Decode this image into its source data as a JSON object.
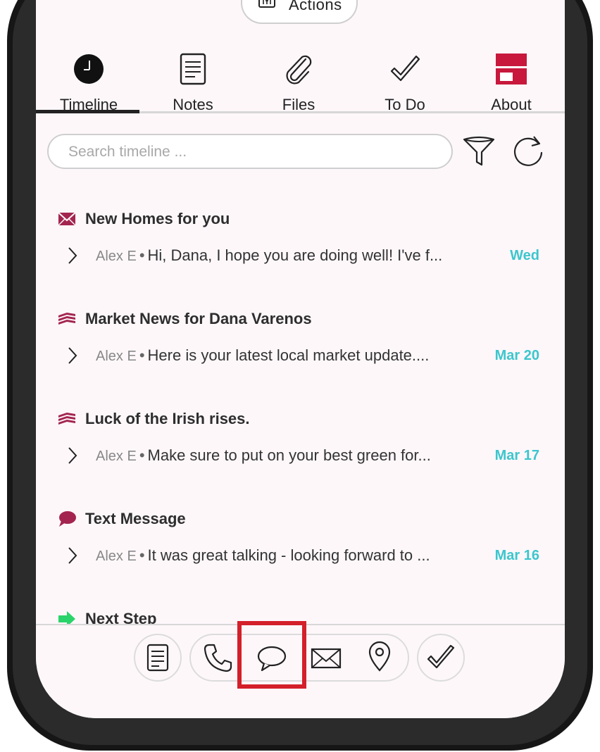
{
  "header": {
    "actions_label": "Actions"
  },
  "tabs": [
    {
      "label": "Timeline",
      "icon": "clock-icon",
      "active": true
    },
    {
      "label": "Notes",
      "icon": "notes-icon",
      "active": false
    },
    {
      "label": "Files",
      "icon": "paperclip-icon",
      "active": false
    },
    {
      "label": "To Do",
      "icon": "checkmark-icon",
      "active": false
    },
    {
      "label": "About",
      "icon": "about-card-icon",
      "active": false
    }
  ],
  "search": {
    "placeholder": "Search timeline ...",
    "value": ""
  },
  "timeline": [
    {
      "type_icon": "envelope-icon",
      "title": "New Homes for you",
      "author": "Alex E",
      "preview": "Hi, Dana, I hope you are doing well! I've f...",
      "date": "Wed"
    },
    {
      "type_icon": "newsletter-stack-icon",
      "title": "Market News for Dana Varenos",
      "author": "Alex E",
      "preview": "Here is your latest local market update....",
      "date": "Mar 20"
    },
    {
      "type_icon": "newsletter-stack-icon",
      "title": "Luck of the Irish rises.",
      "author": "Alex E",
      "preview": "Make sure to put on your best green for...",
      "date": "Mar 17"
    },
    {
      "type_icon": "speech-bubble-icon",
      "title": "Text Message",
      "author": "Alex E",
      "preview": "It was great talking - looking forward to ...",
      "date": "Mar 16"
    },
    {
      "type_icon": "arrow-right-icon",
      "title": "Next Step",
      "author": "",
      "preview": "",
      "date": ""
    }
  ],
  "bottom_bar": [
    {
      "icon": "note-icon"
    },
    {
      "icon": "phone-icon"
    },
    {
      "icon": "chat-bubble-icon",
      "highlighted": true
    },
    {
      "icon": "mail-icon"
    },
    {
      "icon": "location-pin-icon"
    },
    {
      "icon": "check-icon"
    }
  ],
  "colors": {
    "accent_magenta": "#a3254f",
    "date_teal": "#3cc6cd",
    "about_red": "#c8183c",
    "next_step_green": "#2bd46a",
    "highlight_red": "#d3202a"
  },
  "separator": "•"
}
